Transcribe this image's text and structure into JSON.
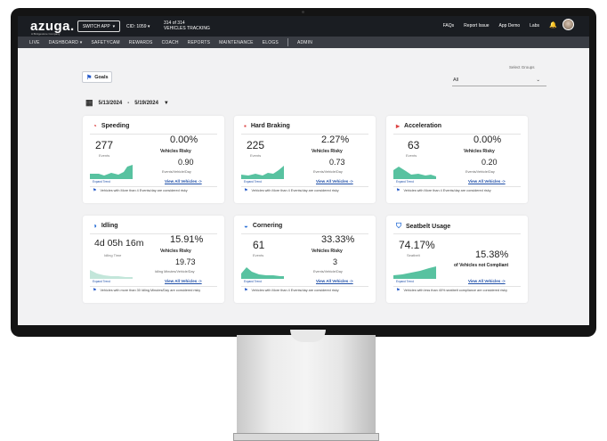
{
  "header": {
    "logo": "azuga.",
    "logo_sub": "A Bridgestone Company",
    "switch_app": "SWITCH APP",
    "cid": "CID: 1059",
    "vehicles_count": "314 of 314",
    "vehicles_label": "VEHICLES TRACKING",
    "links": [
      "FAQs",
      "Report Issue",
      "App Demo",
      "Labs"
    ]
  },
  "nav": {
    "items": [
      "LIVE",
      "DASHBOARD",
      "SAFETYCAM",
      "REWARDS",
      "COACH",
      "REPORTS",
      "MAINTENANCE",
      "ELOGS",
      "ADMIN"
    ]
  },
  "filters": {
    "goals_label": "Goals",
    "select_groups_label": "Select Groups",
    "group_value": "All",
    "date_start": "5/13/2024",
    "date_sep": "-",
    "date_end": "5/19/2024"
  },
  "cards": [
    {
      "title": "Speeding",
      "icon": "speedometer-icon",
      "big_value": "277",
      "big_label": "Events",
      "pct": "0.00%",
      "pct_label": "Vehicles Risky",
      "rate": "0.90",
      "rate_label": "Events/Vehicle/Day",
      "link": "View All Vehicles ->",
      "expand": "Expand Trend",
      "note": "Vehicles with More than 4 Events/day are considered risky"
    },
    {
      "title": "Hard Braking",
      "icon": "brake-icon",
      "big_value": "225",
      "big_label": "Events",
      "pct": "2.27%",
      "pct_label": "Vehicles Risky",
      "rate": "0.73",
      "rate_label": "Events/Vehicle/Day",
      "link": "View All Vehicles ->",
      "expand": "Expand Trend",
      "note": "Vehicles with More than 4 Events/day are considered risky"
    },
    {
      "title": "Acceleration",
      "icon": "acceleration-icon",
      "big_value": "63",
      "big_label": "Events",
      "pct": "0.00%",
      "pct_label": "Vehicles Risky",
      "rate": "0.20",
      "rate_label": "Events/Vehicle/Day",
      "link": "View All Vehicles ->",
      "expand": "Expand Trend",
      "note": "Vehicles with More than 4 Events/day are considered risky"
    },
    {
      "title": "Idling",
      "icon": "idling-icon",
      "big_value": "4d 05h 16m",
      "big_label": "Idling Time",
      "pct": "15.91%",
      "pct_label": "Vehicles Risky",
      "rate": "19.73",
      "rate_label": "Idling Minutes/Vehicle/Day",
      "link": "View All Vehicles ->",
      "expand": "Expand Trend",
      "note": "Vehicles with more than 30 Idling Minutes/Day are considered risky"
    },
    {
      "title": "Cornering",
      "icon": "cornering-icon",
      "big_value": "61",
      "big_label": "Events",
      "pct": "33.33%",
      "pct_label": "Vehicles Risky",
      "rate": "3",
      "rate_label": "Events/Vehicle/Day",
      "link": "View All Vehicles ->",
      "expand": "Expand Trend",
      "note": "Vehicles with More than 4 Events/day are considered risky"
    },
    {
      "title": "Seatbelt Usage",
      "icon": "seatbelt-icon",
      "big_value": "74.17%",
      "big_label": "Seatbelt",
      "pct": "15.38%",
      "pct_label": "of Vehicles not Compliant",
      "link": "View All Vehicles ->",
      "expand": "Expand Trend",
      "note": "Vehicles with less than 40% seatbelt compliance are considered risky"
    }
  ],
  "colors": {
    "topbar": "#1a1d22",
    "nav": "#3a3d44",
    "sparkline": "#58c2a0",
    "link": "#1f4fa8"
  }
}
